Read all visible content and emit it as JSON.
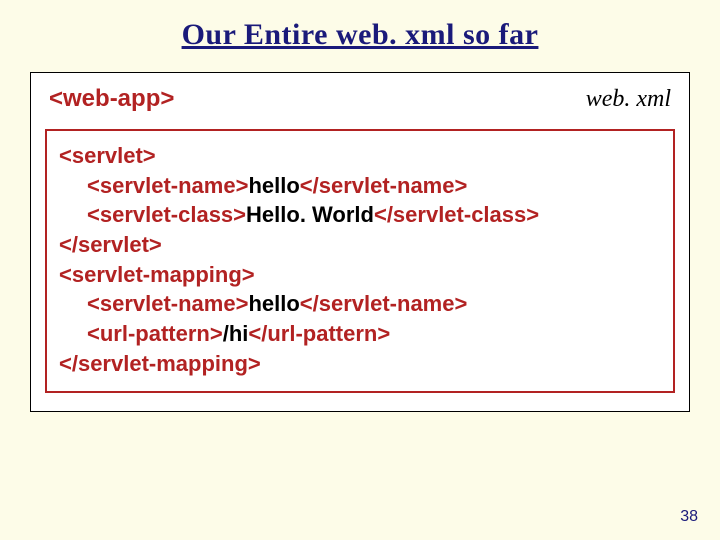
{
  "title": "Our Entire web. xml so far",
  "header": {
    "root_tag": "<web-app>",
    "filename": "web. xml"
  },
  "code": {
    "l1": "<servlet>",
    "l2a": "<servlet-name>",
    "l2b": "hello",
    "l2c": "</servlet-name>",
    "l3a": "<servlet-class>",
    "l3b": "Hello. World",
    "l3c": "</servlet-class>",
    "l4": "</servlet>",
    "l5": "<servlet-mapping>",
    "l6a": "<servlet-name>",
    "l6b": "hello",
    "l6c": "</servlet-name>",
    "l7a": "<url-pattern>",
    "l7b": "/hi",
    "l7c": "</url-pattern>",
    "l8": "</servlet-mapping>"
  },
  "page_number": "38"
}
